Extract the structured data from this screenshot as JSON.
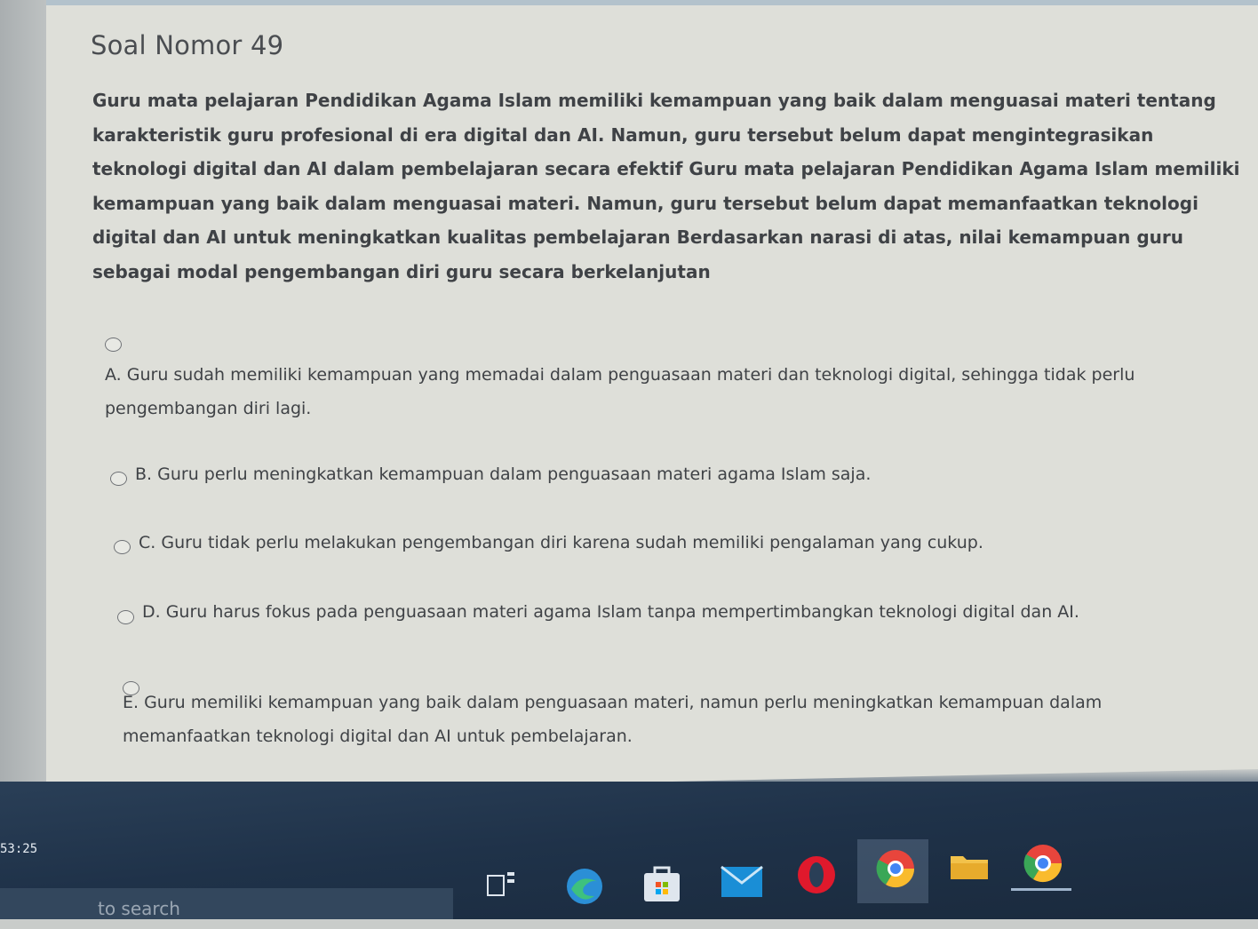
{
  "question": {
    "title": "Soal Nomor 49",
    "text": "Guru mata pelajaran Pendidikan Agama Islam memiliki kemampuan yang baik dalam menguasai materi tentang karakteristik guru profesional di era digital dan AI. Namun, guru tersebut belum dapat mengintegrasikan teknologi digital dan AI dalam pembelajaran secara efektif Guru mata pelajaran Pendidikan Agama Islam memiliki kemampuan yang baik dalam menguasai materi. Namun, guru tersebut belum dapat memanfaatkan teknologi digital dan AI untuk meningkatkan kualitas pembelajaran Berdasarkan narasi di atas, nilai kemampuan guru sebagai modal pengembangan diri guru secara berkelanjutan"
  },
  "options": [
    {
      "label": "A. Guru sudah memiliki kemampuan yang memadai dalam penguasaan materi dan teknologi digital, sehingga tidak perlu pengembangan diri lagi."
    },
    {
      "label": "B. Guru perlu meningkatkan kemampuan dalam penguasaan materi agama Islam saja."
    },
    {
      "label": "C. Guru tidak perlu melakukan pengembangan diri karena sudah memiliki pengalaman yang cukup."
    },
    {
      "label": "D. Guru harus fokus pada penguasaan materi agama Islam tanpa mempertimbangkan teknologi digital dan AI."
    },
    {
      "label": "E. Guru memiliki kemampuan yang baik dalam penguasaan materi, namun perlu meningkatkan kemampuan dalam memanfaatkan teknologi digital dan AI untuk pembelajaran."
    }
  ],
  "taskbar": {
    "clock": "53:25",
    "search_placeholder": "to search",
    "icons": [
      "task-view-icon",
      "edge-icon",
      "store-icon",
      "mail-icon",
      "opera-icon",
      "chrome-icon",
      "file-explorer-icon",
      "chrome-profile-icon"
    ]
  },
  "colors": {
    "card": "#dedfd9",
    "text": "#3f4246",
    "taskbar": "#1f3249"
  }
}
